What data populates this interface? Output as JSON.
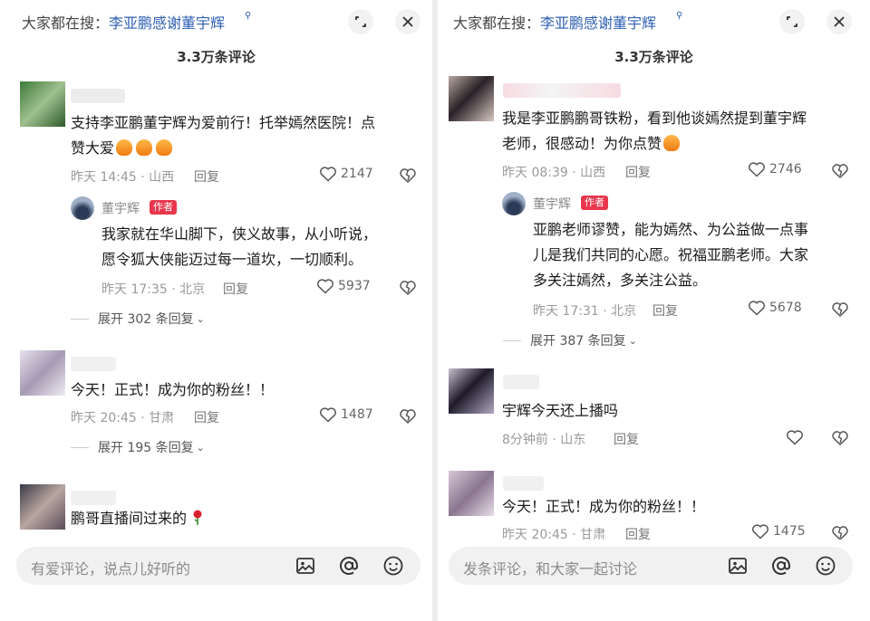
{
  "left": {
    "search_prefix": "大家都在搜：",
    "search_query": "李亚鹏感谢董宇辉",
    "comment_count": "3.3万条评论",
    "comments": [
      {
        "text_line1": "支持李亚鹏董宇辉为爱前行！托举嫣然医院！点",
        "text_line2": "赞大爱",
        "time": "昨天 14:45 · 山西",
        "reply_label": "回复",
        "likes": "2147",
        "author_reply": {
          "name": "董宇辉",
          "tag": "作者",
          "text_line1": "我家就在华山脚下，侠义故事，从小听说，",
          "text_line2": "愿令狐大侠能迈过每一道坎，一切顺利。",
          "time": "昨天 17:35 · 北京",
          "reply_label": "回复",
          "likes": "5937"
        },
        "expand": "展开 302 条回复"
      },
      {
        "text_line1": "今天！正式！成为你的粉丝！！",
        "time": "昨天 20:45 · 甘肃",
        "reply_label": "回复",
        "likes": "1487",
        "expand": "展开 195 条回复"
      },
      {
        "text_line1": "鹏哥直播间过来的"
      }
    ],
    "input_placeholder": "有爱评论，说点儿好听的"
  },
  "right": {
    "search_prefix": "大家都在搜：",
    "search_query": "李亚鹏感谢董宇辉",
    "comment_count": "3.3万条评论",
    "comments": [
      {
        "text_line1": "我是李亚鹏鹏哥铁粉，看到他谈嫣然提到董宇辉",
        "text_line2": "老师，很感动！为你点赞",
        "time": "昨天 08:39 · 山西",
        "reply_label": "回复",
        "likes": "2746",
        "author_reply": {
          "name": "董宇辉",
          "tag": "作者",
          "text_line1": "亚鹏老师谬赞，能为嫣然、为公益做一点事",
          "text_line2": "儿是我们共同的心愿。祝福亚鹏老师。大家",
          "text_line3": "多关注嫣然，多关注公益。",
          "time": "昨天 17:31 · 北京",
          "reply_label": "回复",
          "likes": "5678"
        },
        "expand": "展开 387 条回复"
      },
      {
        "text_line1": "宇辉今天还上播吗",
        "time": "8分钟前 · 山东",
        "reply_label": "回复"
      },
      {
        "text_line1": "今天！正式！成为你的粉丝！！",
        "time": "昨天 20:45 · 甘肃",
        "reply_label": "回复",
        "likes": "1475"
      }
    ],
    "input_placeholder": "发条评论，和大家一起讨论"
  },
  "colors": {
    "query_blue": "#2f5fb3",
    "author_tag_red": "#e8374c",
    "meta_gray": "#9a9a9a"
  },
  "icons": [
    "search-icon",
    "fullscreen-icon",
    "close-icon",
    "heart-icon",
    "dislike-icon",
    "image-icon",
    "at-icon",
    "emoji-icon",
    "thumbs-up-emoji",
    "rose-emoji"
  ]
}
